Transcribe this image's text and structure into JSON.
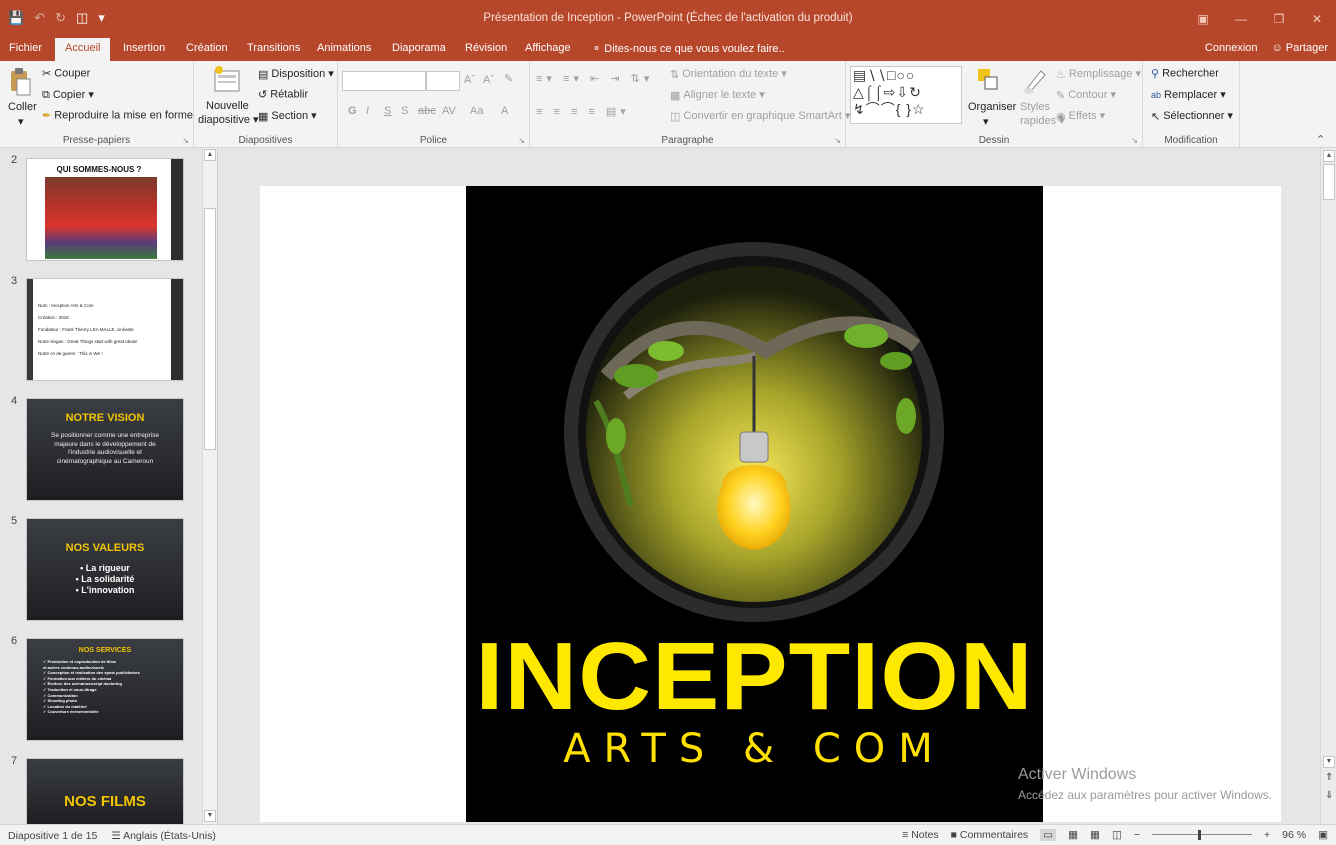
{
  "title_bar": {
    "title": "Présentation de Inception - PowerPoint (Échec de l'activation du produit)"
  },
  "tabs": {
    "items": [
      "Fichier",
      "Accueil",
      "Insertion",
      "Création",
      "Transitions",
      "Animations",
      "Diaporama",
      "Révision",
      "Affichage"
    ],
    "active": "Accueil",
    "tell_me": "Dites-nous ce que vous voulez faire..",
    "signin": "Connexion",
    "share": "Partager"
  },
  "ribbon": {
    "clipboard": {
      "paste": "Coller",
      "cut": "Couper",
      "copy": "Copier",
      "format_painter": "Reproduire la mise en forme",
      "group": "Presse-papiers"
    },
    "slides": {
      "new_slide_l1": "Nouvelle",
      "new_slide_l2": "diapositive",
      "layout": "Disposition",
      "reset": "Rétablir",
      "section": "Section",
      "group": "Diapositives"
    },
    "font": {
      "group": "Police",
      "bold": "G",
      "italic": "I",
      "underline": "S",
      "shadow": "S",
      "strike": "abc",
      "spacing": "AV",
      "case": "Aa",
      "color": "A"
    },
    "paragraph": {
      "text_direction": "Orientation du texte",
      "align_text": "Aligner le texte",
      "smartart": "Convertir en graphique SmartArt",
      "group": "Paragraphe"
    },
    "drawing": {
      "arrange": "Organiser",
      "styles_l1": "Styles",
      "styles_l2": "rapides",
      "fill": "Remplissage",
      "outline": "Contour",
      "effects": "Effets",
      "group": "Dessin"
    },
    "editing": {
      "find": "Rechercher",
      "replace": "Remplacer",
      "select": "Sélectionner",
      "group": "Modification"
    }
  },
  "thumbnails": [
    {
      "num": "2",
      "title": "QUI SOMMES-NOUS ?"
    },
    {
      "num": "3",
      "lines": [
        "Nom : Inception Arts & Com",
        "Création : 2016",
        "Fondateur : Frank Thierry LEA MALLE, cinéaste",
        "Notre slogan : Great Things start with great Ideas!",
        "Notre cri de guerre : This is We !"
      ]
    },
    {
      "num": "4",
      "title": "NOTRE VISION",
      "body": "Se positionner comme une entreprise majeure dans le développement de l'industrie audiovisuelle et cinématographique au Cameroun"
    },
    {
      "num": "5",
      "title": "NOS VALEURS",
      "bullets": [
        "• La rigueur",
        "• La solidarité",
        "• L'innovation"
      ]
    },
    {
      "num": "6",
      "title": "NOS SERVICES",
      "bullets": [
        "✓ Production et coproduction de films",
        "et autres contenus audiovisuels",
        "✓ Conception et réalisation des spots publicitaires",
        "✓ Formation aux métiers du cinéma",
        "✓ Écriture des scénarios/script doctoring",
        "✓ Traduction et sous-titrage",
        "✓ Communication",
        "✓ Shooting photo",
        "✓ Location du matériel",
        "✓ Couverture événementielle"
      ]
    },
    {
      "num": "7",
      "title": "NOS FILMS"
    }
  ],
  "slide": {
    "logo_title": "INCEPTION",
    "logo_subtitle": "ARTS & COM"
  },
  "watermark": {
    "line1": "Activer Windows",
    "line2": "Accédez aux paramètres pour activer Windows."
  },
  "status_bar": {
    "slide_info": "Diapositive 1 de 15",
    "language": "Anglais (États-Unis)",
    "notes": "Notes",
    "comments": "Commentaires",
    "zoom": "96 %"
  },
  "colors": {
    "accent": "#b7472a",
    "logo_yellow": "#ffe800"
  }
}
